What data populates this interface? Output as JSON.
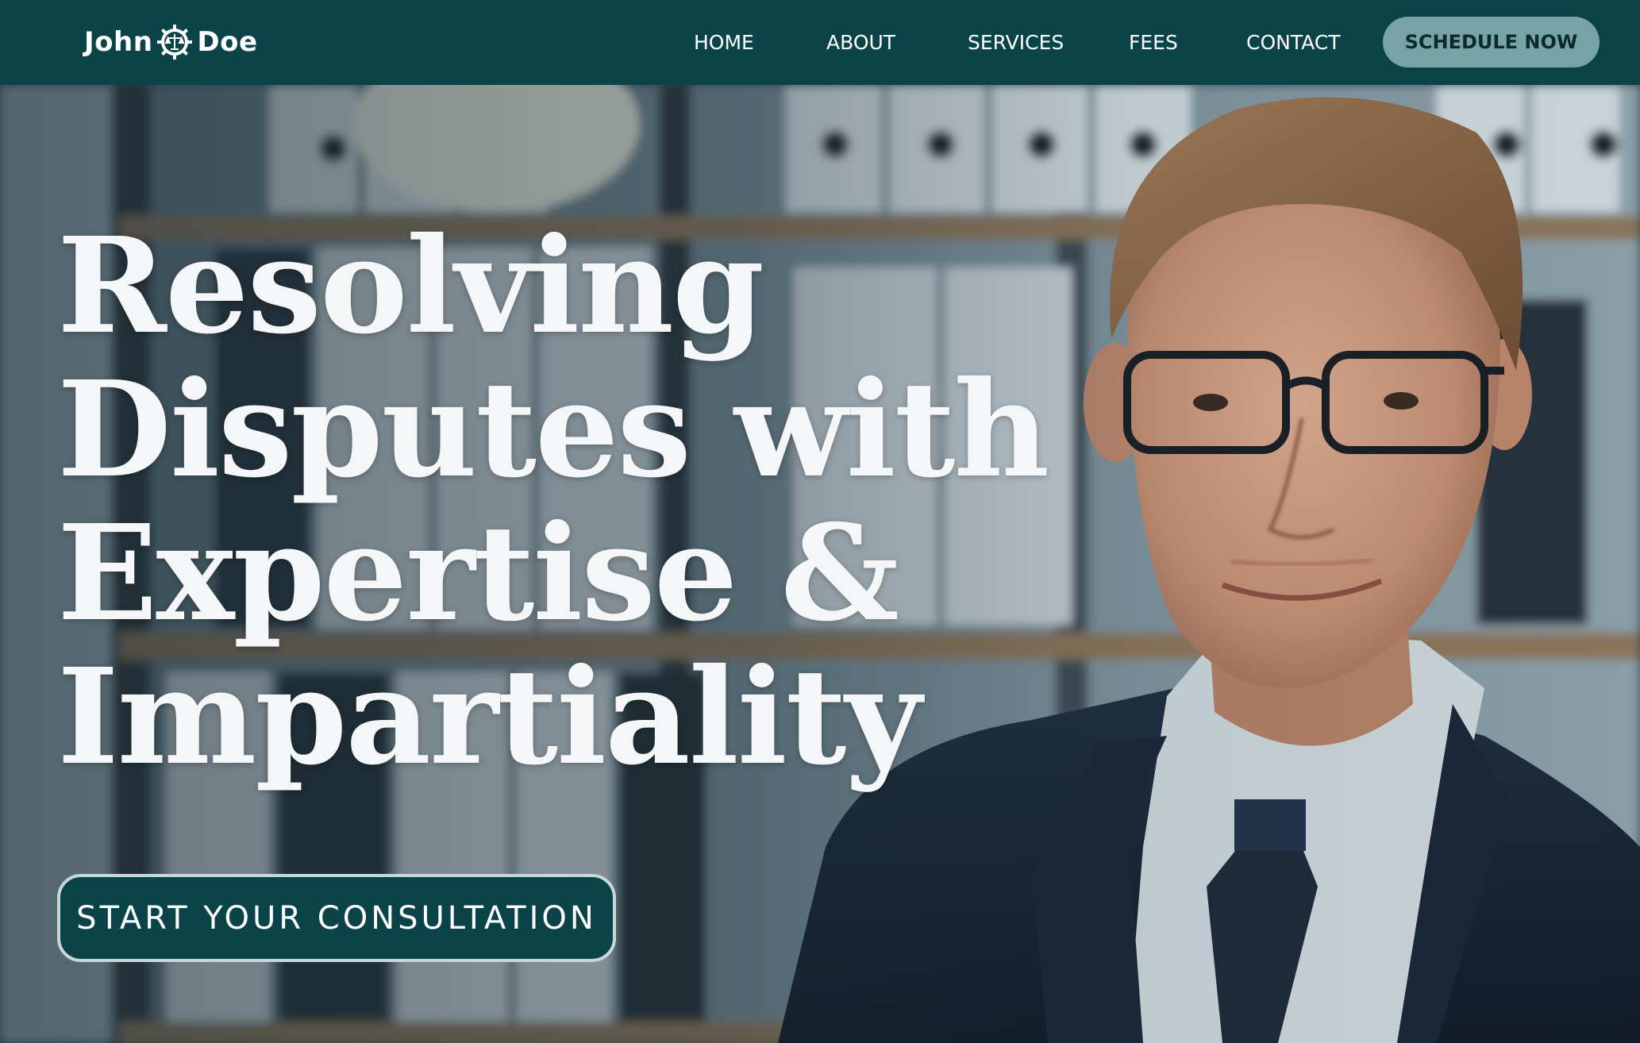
{
  "brand": {
    "logo_left": "John",
    "logo_right": "Doe",
    "logo_emblem": "scales-of-justice-gear-icon",
    "primary_color": "#0a4449",
    "accent_color": "#77a3a6"
  },
  "nav": {
    "items": [
      {
        "label": "HOME"
      },
      {
        "label": "ABOUT"
      },
      {
        "label": "SERVICES"
      },
      {
        "label": "FEES"
      },
      {
        "label": "CONTACT"
      }
    ],
    "cta_label": "SCHEDULE NOW"
  },
  "hero": {
    "headline_lines": [
      "Resolving",
      "Disputes with",
      "Expertise &",
      "Impartiality"
    ],
    "cta_label": "START YOUR CONSULTATION",
    "image": "professional-man-portrait-office-background"
  }
}
